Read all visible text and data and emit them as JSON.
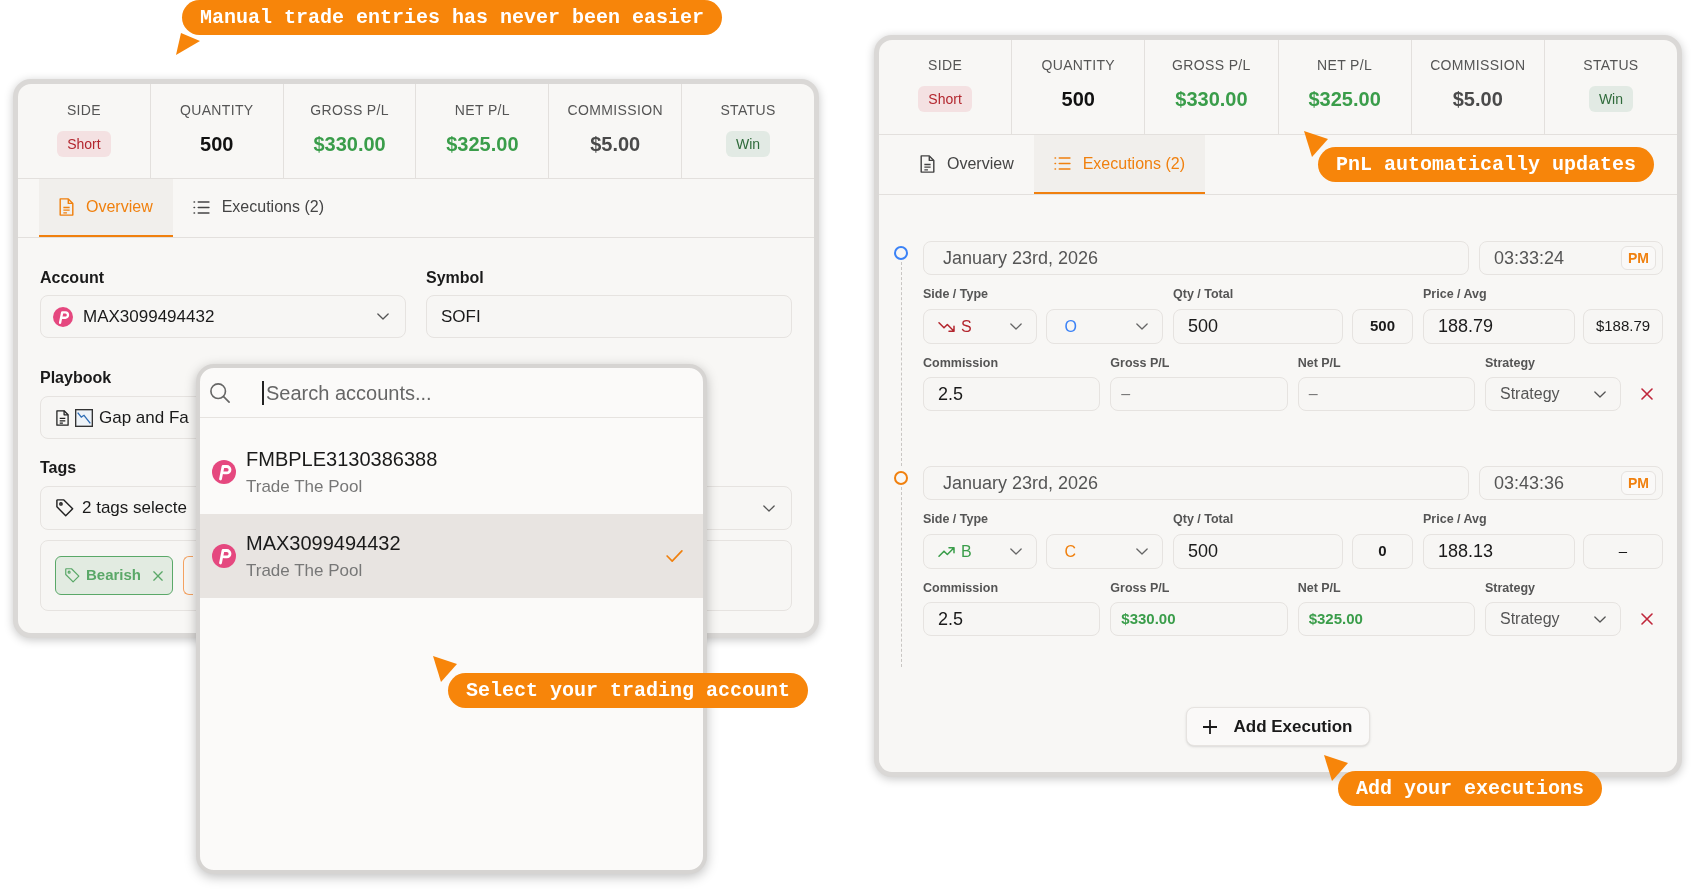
{
  "trade_form": {
    "stats": [
      {
        "label": "SIDE",
        "value": "Short",
        "kind": "badge",
        "color": "#b3262e"
      },
      {
        "label": "QUANTITY",
        "value": "500",
        "kind": "value",
        "color": "#111111"
      },
      {
        "label": "GROSS P/L",
        "value": "$330.00",
        "kind": "value",
        "color": "#3a9d4a"
      },
      {
        "label": "NET P/L",
        "value": "$325.00",
        "kind": "value",
        "color": "#3a9d4a"
      },
      {
        "label": "COMMISSION",
        "value": "$5.00",
        "kind": "value",
        "color": "#4a4a4a"
      },
      {
        "label": "STATUS",
        "value": "Win",
        "kind": "badge",
        "color": "#2f6b3b"
      }
    ],
    "tabs": [
      {
        "label": "Overview",
        "kind": "overview",
        "selected": true
      },
      {
        "label": "Executions (2)",
        "kind": "executions",
        "selected": false
      }
    ],
    "account": {
      "label": "Account",
      "value": "MAX3099494432"
    },
    "symbol": {
      "label": "Symbol",
      "value": "SOFI"
    },
    "playbook": {
      "label": "Playbook",
      "value": "Gap and Fa"
    },
    "tags": {
      "label": "Tags",
      "value": "2 tags selecte",
      "chips": [
        {
          "label": "Bearish",
          "color": "#5aa868"
        },
        {
          "color": "#f4a261"
        }
      ]
    },
    "account_dropdown": {
      "placeholder": "Search accounts...",
      "items": [
        {
          "name": "FMBPLE3130386388",
          "broker": "Trade The Pool",
          "selected": false
        },
        {
          "name": "MAX3099494432",
          "broker": "Trade The Pool",
          "selected": true
        }
      ]
    }
  },
  "trade_detail": {
    "stats": [
      {
        "label": "SIDE",
        "value": "Short",
        "kind": "badge",
        "color": "#b3262e"
      },
      {
        "label": "QUANTITY",
        "value": "500",
        "kind": "value",
        "color": "#111111"
      },
      {
        "label": "GROSS P/L",
        "value": "$330.00",
        "kind": "value",
        "color": "#3a9d4a"
      },
      {
        "label": "NET P/L",
        "value": "$325.00",
        "kind": "value",
        "color": "#3a9d4a"
      },
      {
        "label": "COMMISSION",
        "value": "$5.00",
        "kind": "value",
        "color": "#4a4a4a"
      },
      {
        "label": "STATUS",
        "value": "Win",
        "kind": "badge",
        "color": "#2f6b3b"
      }
    ],
    "tabs": [
      {
        "label": "Overview",
        "kind": "overview",
        "selected": false
      },
      {
        "label": "Executions (2)",
        "kind": "executions",
        "selected": true
      }
    ],
    "executions": [
      {
        "color": "#3b82f6",
        "date": "January 23rd, 2026",
        "time": "03:33:24",
        "meridiem": "PM",
        "side_type": {
          "label": "Side / Type",
          "side": {
            "value": "S",
            "kind": "sell"
          },
          "type": "O"
        },
        "qty_total": {
          "label": "Qty / Total",
          "qty": "500",
          "total": "500"
        },
        "price_avg": {
          "label": "Price / Avg",
          "price": "188.79",
          "avg": "$188.79"
        },
        "commission": {
          "label": "Commission",
          "value": "2.5"
        },
        "gross_pl": {
          "label": "Gross P/L",
          "placeholder": "–"
        },
        "net_pl": {
          "label": "Net P/L",
          "placeholder": "–"
        },
        "strategy": {
          "label": "Strategy",
          "placeholder": "Strategy"
        }
      },
      {
        "color": "#f0800e",
        "date": "January 23rd, 2026",
        "time": "03:43:36",
        "meridiem": "PM",
        "side_type": {
          "label": "Side / Type",
          "side": {
            "value": "B",
            "kind": "buy"
          },
          "type": "C"
        },
        "qty_total": {
          "label": "Qty / Total",
          "qty": "500",
          "total": "0"
        },
        "price_avg": {
          "label": "Price / Avg",
          "price": "188.13",
          "avg": "–"
        },
        "commission": {
          "label": "Commission",
          "value": "2.5"
        },
        "gross_pl": {
          "label": "Gross P/L",
          "value": "$330.00"
        },
        "net_pl": {
          "label": "Net P/L",
          "value": "$325.00"
        },
        "strategy": {
          "label": "Strategy",
          "placeholder": "Strategy"
        }
      }
    ],
    "add_button": "Add Execution"
  },
  "callouts": [
    "Manual trade entries has never been easier",
    "PnL automatically updates",
    "Select your trading account",
    "Add your executions"
  ]
}
